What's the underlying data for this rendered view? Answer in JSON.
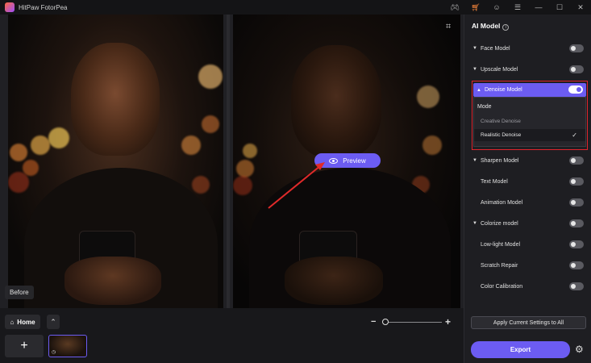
{
  "app": {
    "title": "HitPaw FotorPea"
  },
  "canvas": {
    "before_label": "Before",
    "preview_label": "Preview"
  },
  "panel": {
    "title": "AI Model",
    "models": [
      {
        "label": "Face Model",
        "expandable": true,
        "on": false
      },
      {
        "label": "Upscale Model",
        "expandable": true,
        "on": false
      },
      {
        "label": "Denoise Model",
        "expandable": true,
        "on": true,
        "expanded": true
      },
      {
        "label": "Sharpen Model",
        "expandable": true,
        "on": false
      },
      {
        "label": "Text Model",
        "expandable": false,
        "on": false
      },
      {
        "label": "Animation Model",
        "expandable": false,
        "on": false
      },
      {
        "label": "Colorize model",
        "expandable": true,
        "on": false
      },
      {
        "label": "Low-light Model",
        "expandable": false,
        "on": false
      },
      {
        "label": "Scratch Repair",
        "expandable": false,
        "on": false
      },
      {
        "label": "Color Calibration",
        "expandable": false,
        "on": false
      }
    ],
    "denoise_mode": {
      "title": "Mode",
      "options": [
        "Creative Denoise",
        "Realistic Denoise"
      ],
      "selected": "Realistic Denoise"
    },
    "apply_label": "Apply Current Settings to All",
    "export_label": "Export"
  },
  "bottom": {
    "home_label": "Home",
    "add_symbol": "+"
  },
  "colors": {
    "accent": "#6c5cf2",
    "highlight_border": "#e0242c"
  }
}
